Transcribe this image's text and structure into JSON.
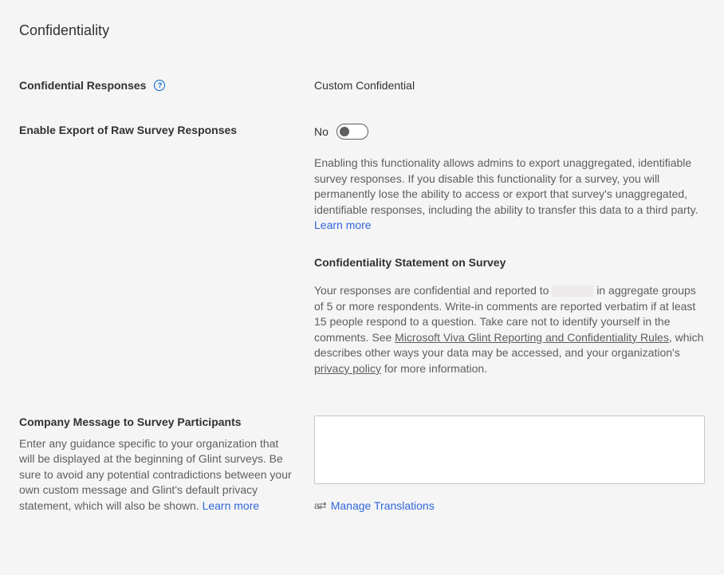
{
  "title": "Confidentiality",
  "confidentialResponses": {
    "label": "Confidential Responses",
    "value": "Custom Confidential"
  },
  "enableExport": {
    "label": "Enable Export of Raw Survey Responses",
    "toggleState": "No",
    "helpText": "Enabling this functionality allows admins to export unaggregated, identifiable survey responses. If you disable this functionality for a survey, you will permanently lose the ability to access or export that survey's unaggregated, identifiable responses, including the ability to transfer this data to a third party. ",
    "learnMore": "Learn more"
  },
  "confidentialityStatement": {
    "heading": "Confidentiality Statement on Survey",
    "part1": "Your responses are confidential and reported to ",
    "part2": " in aggregate groups of 5 or more respondents. Write-in comments are reported verbatim if at least 15 people respond to a question. Take care not to identify yourself in the comments. See ",
    "link1": "Microsoft Viva Glint Reporting and Confidentiality Rules",
    "part3": ", which describes other ways your data may be accessed, and your organization's ",
    "link2": "privacy policy",
    "part4": " for more information."
  },
  "companyMessage": {
    "label": "Company Message to Survey Participants",
    "desc": "Enter any guidance specific to your organization that will be displayed at the beginning of Glint surveys. Be sure to avoid any potential contradictions between your own custom message and Glint's default privacy statement, which will also be shown. ",
    "learnMore": "Learn more",
    "value": "",
    "manageTranslations": "Manage Translations"
  }
}
